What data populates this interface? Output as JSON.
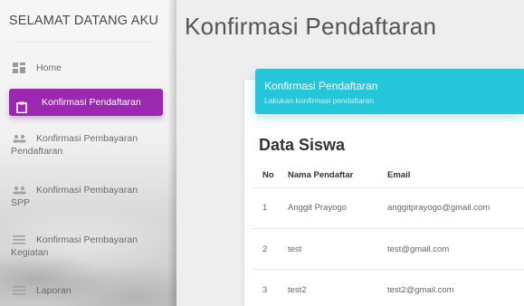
{
  "sidebar": {
    "brand": "SELAMAT DATANG AKU",
    "items": [
      {
        "label": "Home",
        "icon": "dashboard-icon"
      },
      {
        "label": "Konfirmasi Pendaftaran",
        "icon": "clipboard-icon",
        "active": true
      },
      {
        "label": "Konfirmasi Pembayaran",
        "label2": "Pendaftaran",
        "icon": "people-icon"
      },
      {
        "label": "Konfirmasi Pembayaran",
        "label2": "SPP",
        "icon": "people-icon"
      },
      {
        "label": "Konfirmasi Pembayaran",
        "label2": "Kegiatan",
        "icon": "list-icon"
      },
      {
        "label": "Laporan",
        "icon": "list-icon"
      }
    ],
    "accent": "#9c27b0"
  },
  "main": {
    "page_title": "Konfirmasi Pendaftaran",
    "card": {
      "header_title": "Konfirmasi Pendaftaran",
      "header_subtitle": "Lakukan konfirmasi pendaftaran",
      "header_color": "#26c6da",
      "section_title": "Data Siswa",
      "table": {
        "columns": [
          "No",
          "Nama Pendaftar",
          "Email"
        ],
        "rows": [
          [
            "1",
            "Anggit Prayogo",
            "anggitprayogo@gmail.com"
          ],
          [
            "2",
            "test",
            "test@gmail.com"
          ],
          [
            "3",
            "test2",
            "test2@gmail.com"
          ]
        ]
      }
    }
  }
}
